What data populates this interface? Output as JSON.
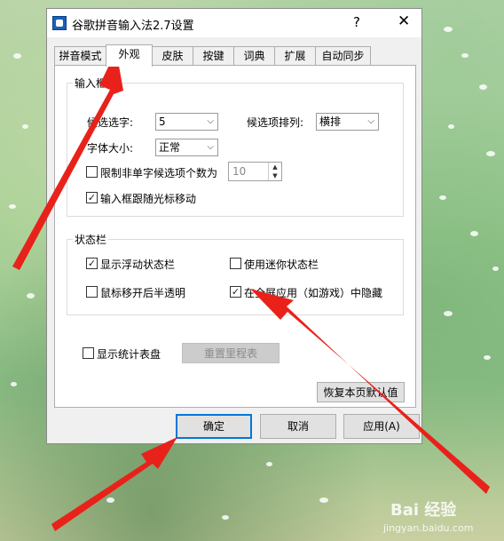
{
  "window": {
    "title": "谷歌拼音输入法2.7设置",
    "help": "?",
    "close": "✕"
  },
  "tabs": [
    "拼音模式",
    "外观",
    "皮肤",
    "按键",
    "词典",
    "扩展",
    "自动同步"
  ],
  "input_box": {
    "group_title": "输入框",
    "candidates_label": "候选选字:",
    "candidates_value": "5",
    "arrangement_label": "候选项排列:",
    "arrangement_value": "横排",
    "font_size_label": "字体大小:",
    "font_size_value": "正常",
    "limit_label": "限制非单字候选项个数为",
    "limit_checked": false,
    "limit_value": "10",
    "follow_cursor_label": "输入框跟随光标移动",
    "follow_cursor_checked": true
  },
  "status_bar": {
    "group_title": "状态栏",
    "float_label": "显示浮动状态栏",
    "float_checked": true,
    "mini_label": "使用迷你状态栏",
    "mini_checked": false,
    "translucent_label": "鼠标移开后半透明",
    "translucent_checked": false,
    "hide_fullscreen_label": "在全屏应用（如游戏）中隐藏",
    "hide_fullscreen_checked": true
  },
  "stats": {
    "show_label": "显示统计表盘",
    "show_checked": false,
    "reset_button": "重置里程表"
  },
  "restore_button": "恢复本页默认值",
  "footer": {
    "ok": "确定",
    "cancel": "取消",
    "apply": "应用(A)"
  },
  "watermark": {
    "brand": "Bai 经验",
    "url": "jingyan.baidu.com"
  },
  "colors": {
    "arrow": "#e8221b",
    "accent": "#0078d7"
  }
}
